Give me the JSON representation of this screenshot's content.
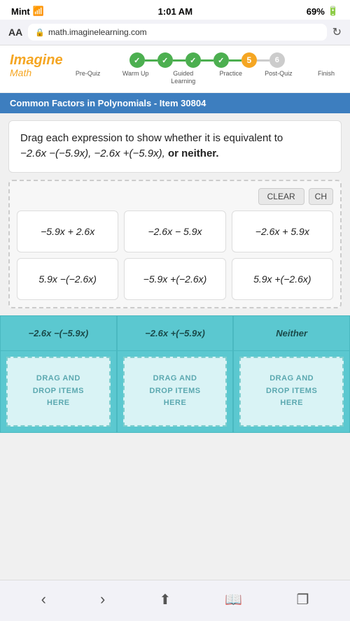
{
  "statusBar": {
    "carrier": "Mint",
    "time": "1:01 AM",
    "battery": "69%"
  },
  "browserBar": {
    "aa": "AA",
    "url": "math.imaginelearning.com",
    "refresh": "↻"
  },
  "brand": {
    "imagine": "Imagine",
    "math": "Math"
  },
  "progressSteps": [
    {
      "label": "Pre-Quiz",
      "state": "completed",
      "symbol": "✓"
    },
    {
      "label": "Warm Up",
      "state": "completed",
      "symbol": "✓"
    },
    {
      "label": "Guided\nLearning",
      "state": "completed",
      "symbol": "✓"
    },
    {
      "label": "Practice",
      "state": "completed",
      "symbol": "✓"
    },
    {
      "label": "Post-Quiz",
      "state": "active",
      "number": "5"
    },
    {
      "label": "Finish",
      "state": "upcoming",
      "number": "6"
    }
  ],
  "sectionTitle": "Common Factors in Polynomials - Item 30804",
  "instruction": {
    "main": "Drag each expression to show whether it is equivalent to",
    "expr1": "−2.6x −(−5.9x),",
    "expr2": "−2.6x +(−5.9x),",
    "orNeither": "or neither."
  },
  "buttons": {
    "clear": "CLEAR",
    "ch": "CH"
  },
  "expressions": [
    {
      "id": 1,
      "text": "−5.9x + 2.6x"
    },
    {
      "id": 2,
      "text": "−2.6x − 5.9x"
    },
    {
      "id": 3,
      "text": "−2.6x + 5.9x"
    },
    {
      "id": 4,
      "text": "5.9x −(−2.6x)"
    },
    {
      "id": 5,
      "text": "−5.9x +(−2.6x)"
    },
    {
      "id": 6,
      "text": "5.9x +(−2.6x)"
    }
  ],
  "dropZones": [
    {
      "id": "zone1",
      "header": "−2.6x −(−5.9x)",
      "hint": "DRAG AND\nDROP ITEMS\nHERE"
    },
    {
      "id": "zone2",
      "header": "−2.6x +(−5.9x)",
      "hint": "DRAG AND\nDROP ITEMS\nHERE"
    },
    {
      "id": "zone3",
      "header": "Neither",
      "hint": "DRAG AND\nDROP ITEMS\nHERE"
    }
  ],
  "bottomNav": {
    "back": "‹",
    "forward": "›",
    "share": "⬆",
    "book": "⊞",
    "copy": "❐"
  }
}
